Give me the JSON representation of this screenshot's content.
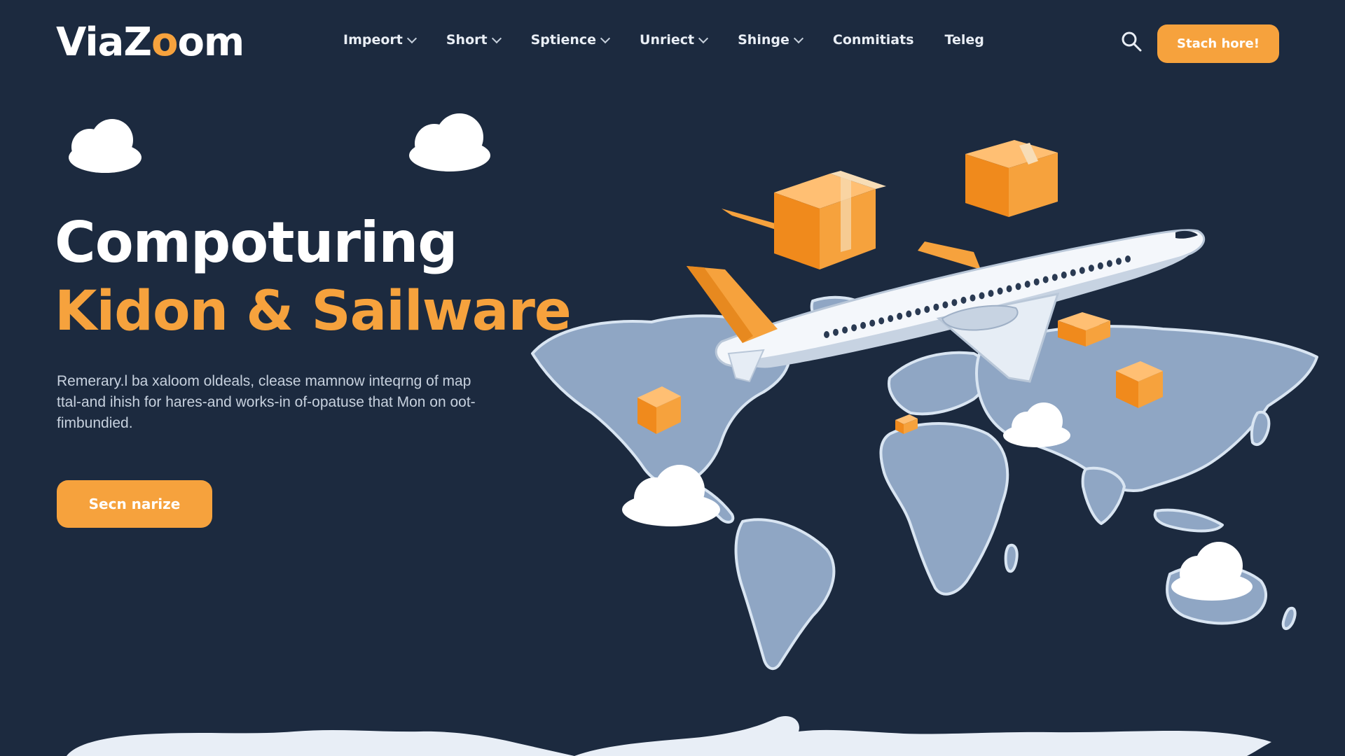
{
  "brand": {
    "name_a": "ViaZ",
    "name_o": "o",
    "name_b": "om"
  },
  "nav": {
    "items": [
      {
        "label": "Impeort",
        "has_dropdown": true
      },
      {
        "label": "Short",
        "has_dropdown": true
      },
      {
        "label": "Sptience",
        "has_dropdown": true
      },
      {
        "label": "Unriect",
        "has_dropdown": true
      },
      {
        "label": "Shinge",
        "has_dropdown": true
      },
      {
        "label": "Conmitiats",
        "has_dropdown": false
      },
      {
        "label": "Teleg",
        "has_dropdown": false
      }
    ],
    "search_icon": "search-icon",
    "cta_label": "Stach hore!"
  },
  "hero": {
    "title_line1": "Compoturing",
    "title_line2": "Kidon & Sailware",
    "description": "Remerary.l ba xaloom oldeals, clease mamnow inteqrng of map ttal-and ihish for hares-and works-in of-opatuse that Mon on oot-fimbundied.",
    "cta_label": "Secn narize"
  },
  "illustration": {
    "icons": [
      "airplane-icon",
      "package-icon",
      "cloud-icon",
      "world-map"
    ]
  },
  "colors": {
    "background": "#1c2a3f",
    "accent": "#f6a23d",
    "map": "#8fa6c4",
    "text_muted": "#c7d1de"
  }
}
